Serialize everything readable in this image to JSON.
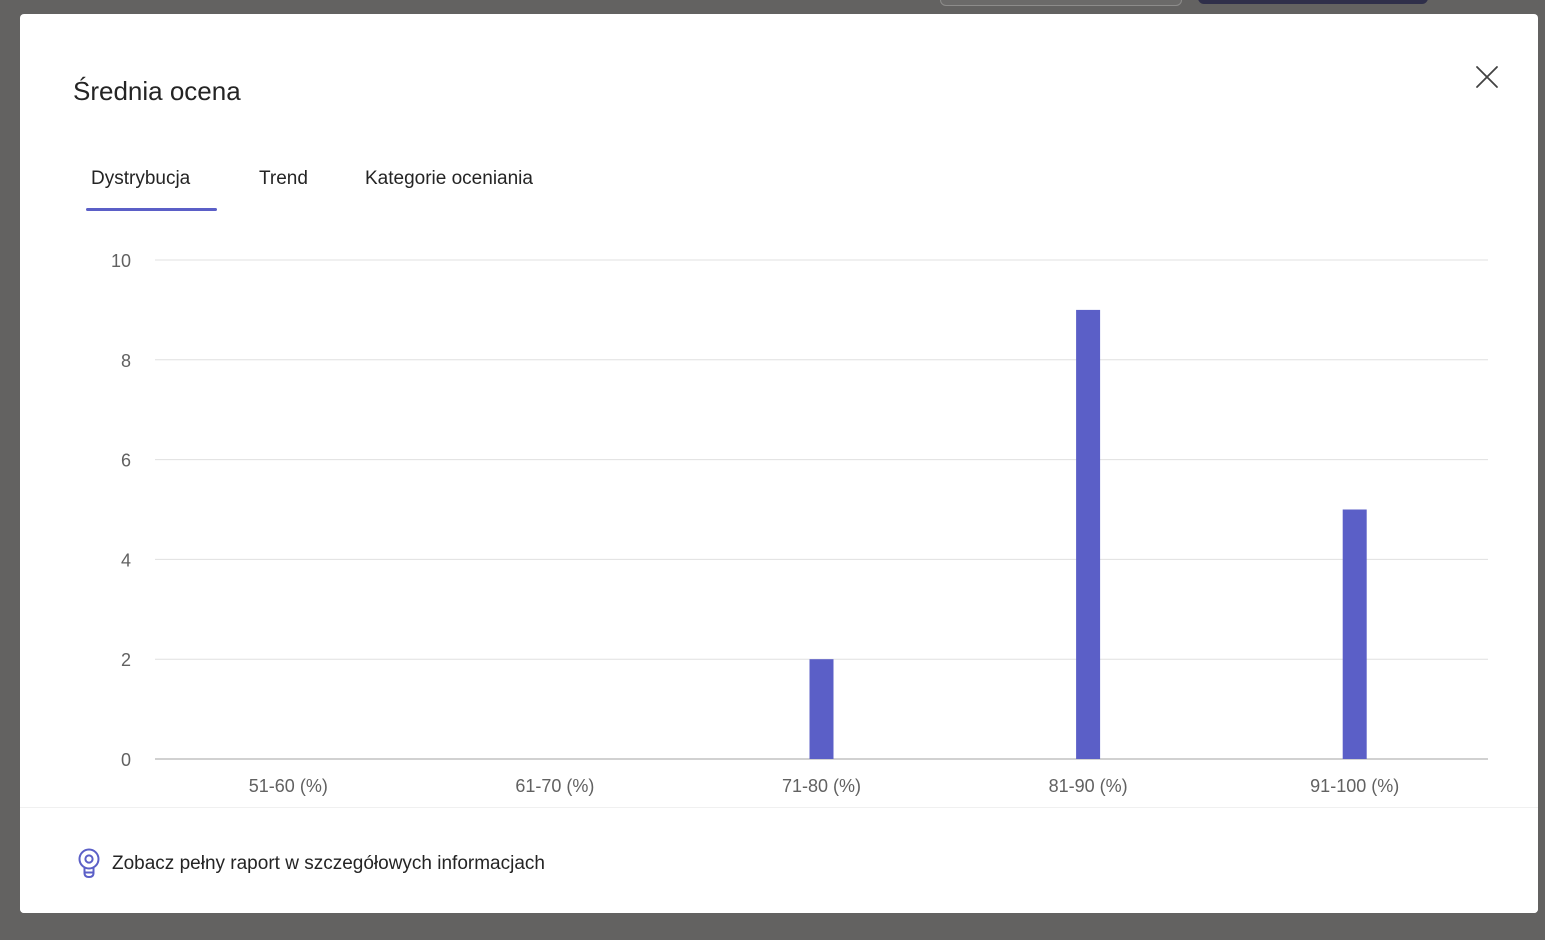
{
  "dialog": {
    "title": "Średnia ocena",
    "close_label": "Zamknij"
  },
  "tabs": [
    {
      "label": "Dystrybucja",
      "active": true
    },
    {
      "label": "Trend",
      "active": false
    },
    {
      "label": "Kategorie oceniania",
      "active": false
    }
  ],
  "colors": {
    "accent": "#5b5fc7",
    "bar": "#5b5fc7",
    "grid": "#e0e0e0",
    "axis_text": "#616161"
  },
  "chart_data": {
    "type": "bar",
    "categories": [
      "51-60 (%)",
      "61-70 (%)",
      "71-80 (%)",
      "81-90 (%)",
      "91-100 (%)"
    ],
    "values": [
      0,
      0,
      2,
      9,
      5
    ],
    "yticks": [
      0,
      2,
      4,
      6,
      8,
      10
    ],
    "ylim": [
      0,
      10
    ],
    "grid": true
  },
  "footer": {
    "link_text": "Zobacz pełny raport w szczegółowych informacjach",
    "icon": "lightbulb-icon"
  }
}
